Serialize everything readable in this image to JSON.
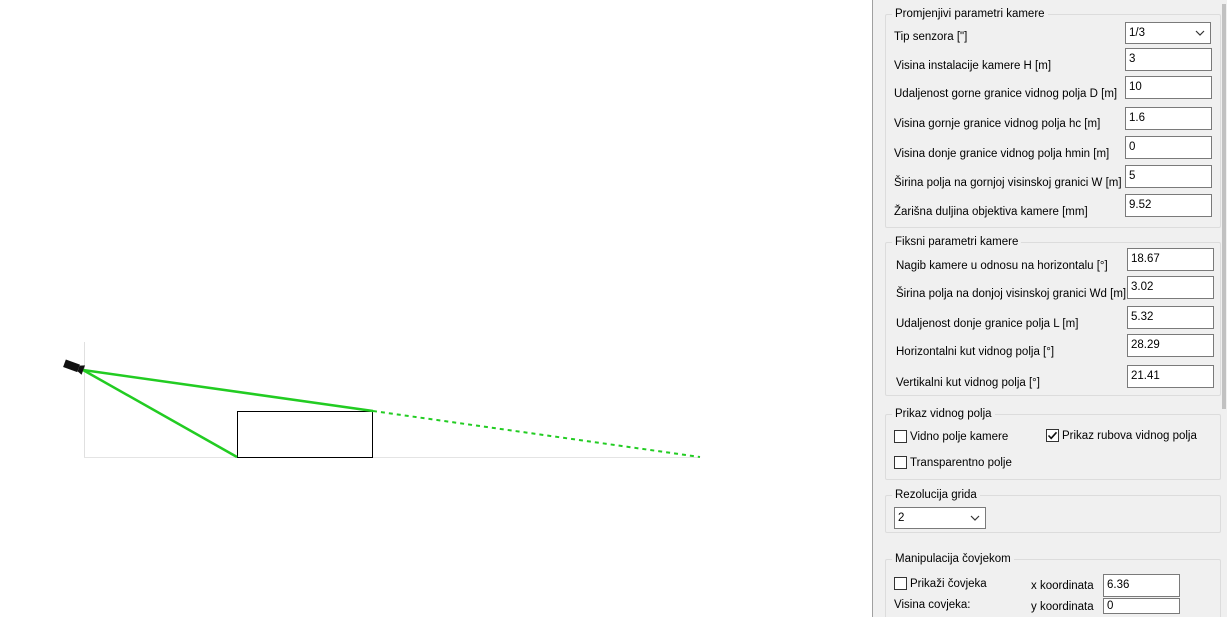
{
  "panel": {
    "variable_group": {
      "title": "Promjenjivi parametri kamere",
      "fields": [
        {
          "label": "Tip senzora [\"]",
          "value": "1/3",
          "kind": "select"
        },
        {
          "label": "Visina instalacije kamere H [m]",
          "value": "3"
        },
        {
          "label": "Udaljenost gorne granice vidnog polja D [m]",
          "value": "10"
        },
        {
          "label": "Visina gornje granice vidnog polja hc [m]",
          "value": "1.6"
        },
        {
          "label": "Visina donje granice vidnog polja hmin [m]",
          "value": "0"
        },
        {
          "label": "Širina polja na gornjoj visinskoj granici W [m]",
          "value": "5"
        },
        {
          "label": "Žarišna duljina objektiva kamere [mm]",
          "value": "9.52"
        }
      ]
    },
    "fixed_group": {
      "title": "Fiksni parametri kamere",
      "fields": [
        {
          "label": "Nagib kamere u odnosu na horizontalu [°]",
          "value": "18.67"
        },
        {
          "label": "Širina polja na donjoj visinskoj granici Wd [m]",
          "value": "3.02"
        },
        {
          "label": "Udaljenost donje granice polja L [m]",
          "value": "5.32"
        },
        {
          "label": "Horizontalni kut vidnog polja [°]",
          "value": "28.29"
        },
        {
          "label": "Vertikalni kut vidnog polja [°]",
          "value": "21.41"
        }
      ]
    },
    "view_group": {
      "title": "Prikaz vidnog polja",
      "options": [
        {
          "label": "Vidno polje kamere",
          "checked": false
        },
        {
          "label": "Prikaz rubova vidnog polja",
          "checked": true
        },
        {
          "label": "Transparentno polje",
          "checked": false
        }
      ]
    },
    "grid_group": {
      "title": "Rezolucija grida",
      "value": "2"
    },
    "person_group": {
      "title": "Manipulacija čovjekom",
      "show_label": "Prikaži čovjeka",
      "show_checked": false,
      "x_label": "x koordinata",
      "x_value": "6.36",
      "y_label": "y koordinata",
      "y_value": "0",
      "height_label": "Visina covjeka:"
    }
  },
  "scene": {
    "fov_edge_color": "#22cc22",
    "camera_icon": "camera-icon",
    "fov_edge_style": "dashed-extension"
  }
}
